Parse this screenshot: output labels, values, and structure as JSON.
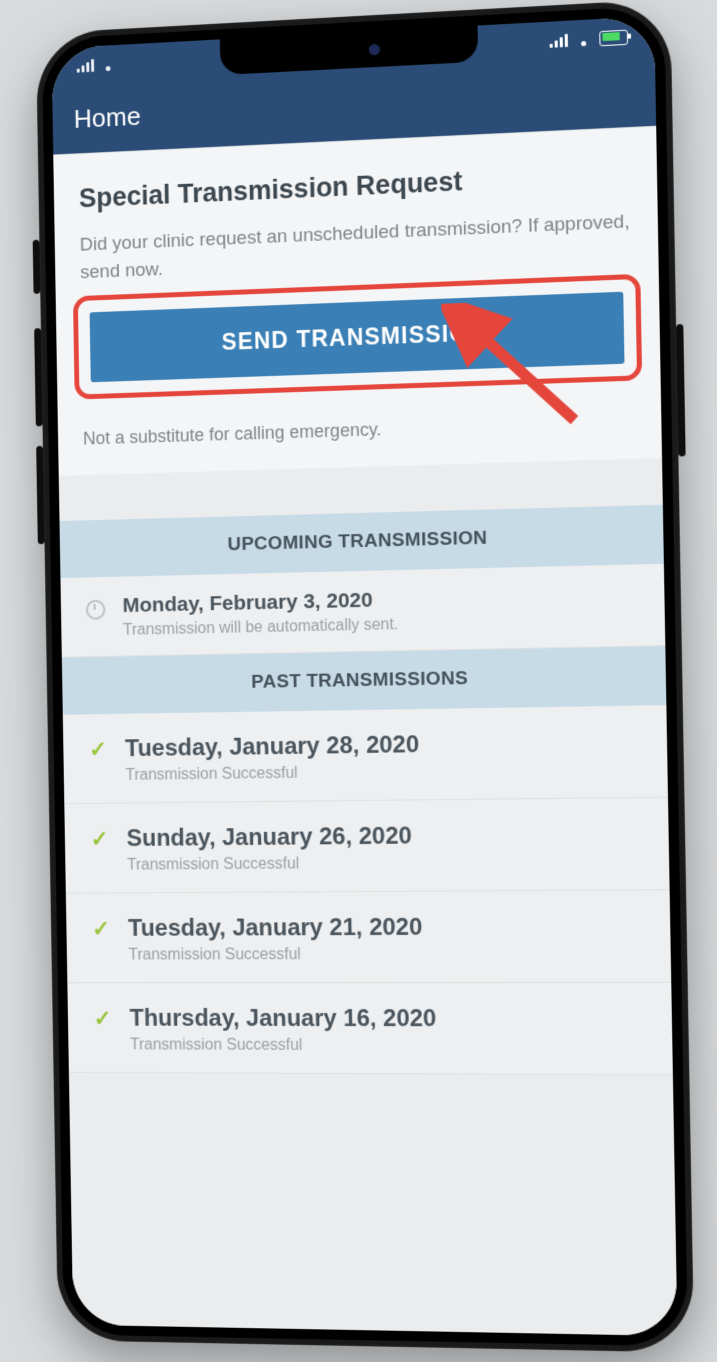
{
  "nav": {
    "title": "Home"
  },
  "request_card": {
    "title": "Special Transmission Request",
    "description": "Did your clinic request an unscheduled transmission? If approved, send now.",
    "button_label": "SEND TRANSMISSION",
    "disclaimer": "Not a substitute for calling emergency."
  },
  "upcoming": {
    "header": "UPCOMING TRANSMISSION",
    "item": {
      "date": "Monday, February 3, 2020",
      "note": "Transmission will be automatically sent."
    }
  },
  "past": {
    "header": "PAST TRANSMISSIONS",
    "items": [
      {
        "date": "Tuesday, January 28, 2020",
        "status": "Transmission Successful"
      },
      {
        "date": "Sunday, January 26, 2020",
        "status": "Transmission Successful"
      },
      {
        "date": "Tuesday, January 21, 2020",
        "status": "Transmission Successful"
      },
      {
        "date": "Thursday, January 16, 2020",
        "status": "Transmission Successful"
      }
    ]
  },
  "annotation": {
    "highlight_color": "#e5463c"
  }
}
